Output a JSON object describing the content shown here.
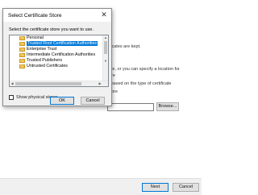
{
  "wizard": {
    "lines": [
      "tificates are kept.",
      "tore, or you can specify a location for",
      "re",
      "e based on the type of certificate",
      "ore",
      ""
    ],
    "browse_label": "Browse...",
    "next_label": "Next",
    "cancel_label": "Cancel"
  },
  "dialog": {
    "title": "Select Certificate Store",
    "close_glyph": "✕",
    "prompt": "Select the certificate store you want to use.",
    "stores": [
      {
        "label": "Personal",
        "selected": false
      },
      {
        "label": "Trusted Root Certification Authorities",
        "selected": true
      },
      {
        "label": "Enterprise Trust",
        "selected": false
      },
      {
        "label": "Intermediate Certification Authorities",
        "selected": false
      },
      {
        "label": "Trusted Publishers",
        "selected": false
      },
      {
        "label": "Untrusted Certificates",
        "selected": false
      }
    ],
    "scroll_up": "▲",
    "scroll_down": "▼",
    "scroll_left": "◀",
    "scroll_right": "▶",
    "show_physical_label": "Show physical stores",
    "show_physical_checked": false,
    "ok_label": "OK",
    "cancel_label": "Cancel"
  }
}
